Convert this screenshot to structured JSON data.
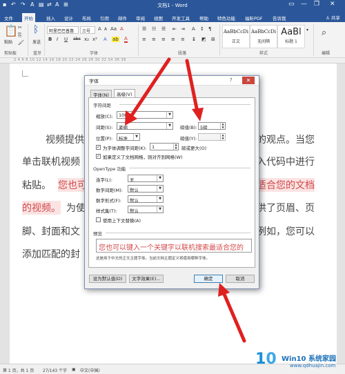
{
  "window": {
    "title": "文档1 - Word",
    "quick_access": [
      "↶",
      "↷",
      "A",
      "▤",
      "⇄",
      "A",
      "⊞"
    ],
    "controls": [
      "▭",
      "—",
      "❐",
      "✕"
    ]
  },
  "tabs": {
    "items": [
      "文件",
      "开始",
      "插入",
      "设计",
      "布局",
      "引用",
      "邮件",
      "审阅",
      "视图",
      "开发工具",
      "帮助",
      "特色功能",
      "福昕PDF",
      "告诉我"
    ],
    "active_index": 1,
    "share": "共享"
  },
  "ribbon": {
    "clipboard": {
      "label": "剪贴板",
      "paste": "粘贴"
    },
    "bluetooth": {
      "label": "蓝牙",
      "send": "发送"
    },
    "font": {
      "label": "字体",
      "font_name": "阿里巴巴普惠",
      "font_size": "三号",
      "row2": [
        "B",
        "I",
        "U",
        "abc",
        "x₂",
        "x²",
        "A"
      ]
    },
    "paragraph": {
      "label": "段落"
    },
    "styles": {
      "label": "样式",
      "items": [
        {
          "sample": "AaBbCcDi",
          "name": "正文"
        },
        {
          "sample": "AaBbCcDi",
          "name": "无间隔"
        },
        {
          "sample": "AaBl",
          "name": "标题 1"
        }
      ]
    },
    "editing": {
      "label": "编辑"
    }
  },
  "ruler": {
    "numbers": "2  4  6  8  10  12  14  16  18  20  22  24  26  28  30  32  34  36  38"
  },
  "document": {
    "line1_left": "视频提供",
    "line1_right": "的观点。当您",
    "line2_left": "单击联机视频",
    "line2_right": "入代码中进行",
    "line3_left": "粘贴。",
    "line3_hl_left": "您也可",
    "line3_hl_right": "适合您的文档",
    "line4_hl": "的视频。",
    "line4_left": "为使",
    "line4_right": "供了页眉、页",
    "line5_left": "脚、封面和文",
    "line5_right": "例如，您可以",
    "line6_left": "添加匹配的封"
  },
  "dialog": {
    "title": "字体",
    "help": "?",
    "close": "✕",
    "tabs": [
      "字体(N)",
      "高级(V)"
    ],
    "active_tab": 1,
    "spacing_section": "字符间距",
    "scale_label": "缩放(C):",
    "scale_value": "100%",
    "spacing_label": "间距(S):",
    "spacing_value": "紧缩",
    "points_label": "磅值(B):",
    "points_value": "5磅",
    "position_label": "位置(P):",
    "position_value": "标准",
    "position_points_label": "磅值(Y):",
    "kerning_label": "为字体调整字间距(K):",
    "kerning_value": "1",
    "kerning_suffix": "磅或更大(O)",
    "grid_label": "如果定义了文档网格，则对齐到网格(W)",
    "opentype_section": "OpenType 功能",
    "ligatures_label": "连字(L):",
    "ligatures_value": "无",
    "numspacing_label": "数字间距(M):",
    "numspacing_value": "默认",
    "numform_label": "数字形式(F):",
    "numform_value": "默认",
    "stylesets_label": "样式集(T):",
    "stylesets_value": "默认",
    "contextual_label": "使用上下文替换(A)",
    "preview_section": "预览",
    "preview_text": "您也可以键入一个关键字以联机搜索最适合您的",
    "note": "这是用于中文的正文主题字体。当前文档主题定义将使用哪种字体。",
    "btn_default": "设为默认值(D)",
    "btn_effects": "文字效果(E)...",
    "btn_ok": "确定",
    "btn_cancel": "取消"
  },
  "status": {
    "page": "第 1 页，共 1 页",
    "words": "27/143 个字",
    "lang": "中文(中国)"
  },
  "watermark": {
    "logo_prefix": "1",
    "logo_accent": "0",
    "brand": "Win10 系统家园",
    "site": "www.qdhuajin.com"
  },
  "colors": {
    "title_bar": "#2b579a",
    "highlight_text": "#d24a4a",
    "arrow": "#e02020"
  }
}
